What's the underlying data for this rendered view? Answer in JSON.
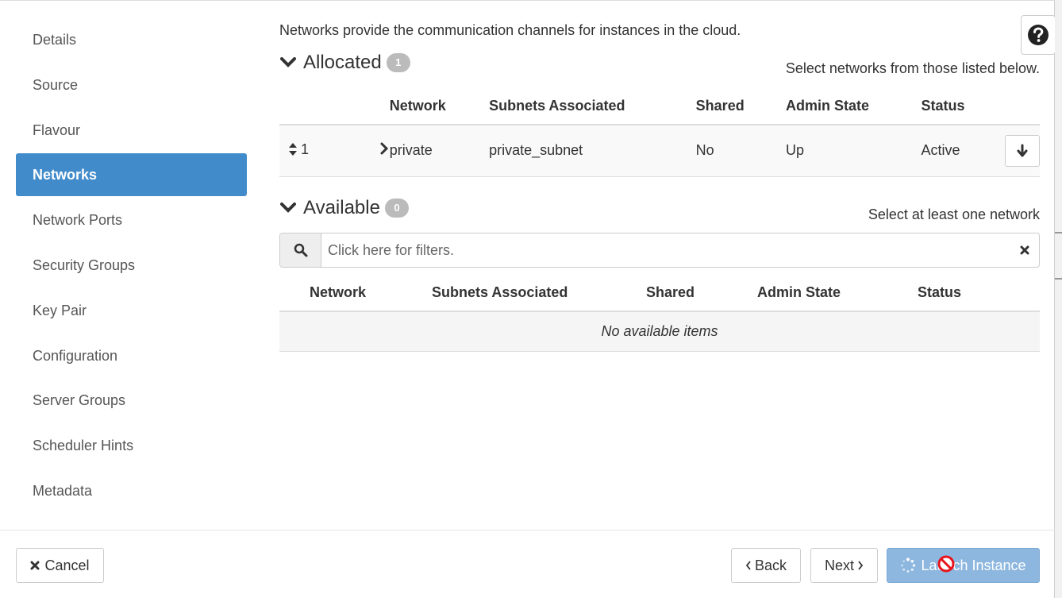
{
  "sidebar": {
    "items": [
      {
        "label": "Details"
      },
      {
        "label": "Source"
      },
      {
        "label": "Flavour"
      },
      {
        "label": "Networks"
      },
      {
        "label": "Network Ports"
      },
      {
        "label": "Security Groups"
      },
      {
        "label": "Key Pair"
      },
      {
        "label": "Configuration"
      },
      {
        "label": "Server Groups"
      },
      {
        "label": "Scheduler Hints"
      },
      {
        "label": "Metadata"
      }
    ],
    "active": "Networks"
  },
  "main": {
    "intro": "Networks provide the communication channels for instances in the cloud.",
    "allocated": {
      "title": "Allocated",
      "count": "1",
      "hint": "Select networks from those listed below.",
      "columns": [
        "Network",
        "Subnets Associated",
        "Shared",
        "Admin State",
        "Status"
      ],
      "rows": [
        {
          "order": "1",
          "network": "private",
          "subnets": "private_subnet",
          "shared": "No",
          "admin_state": "Up",
          "status": "Active"
        }
      ]
    },
    "available": {
      "title": "Available",
      "count": "0",
      "hint": "Select at least one network",
      "filter_placeholder": "Click here for filters.",
      "columns": [
        "Network",
        "Subnets Associated",
        "Shared",
        "Admin State",
        "Status"
      ],
      "empty_text": "No available items"
    }
  },
  "footer": {
    "cancel_label": "Cancel",
    "back_label": "Back",
    "next_label": "Next",
    "launch_label": "Launch Instance"
  },
  "colors": {
    "active_nav": "#428bca",
    "launch_button": "#8db7df",
    "badge": "#bbbbbb"
  },
  "icons": [
    "question-circle-icon",
    "chevron-down-icon",
    "sort-icon",
    "chevron-right-icon",
    "arrow-down-icon",
    "search-icon",
    "times-icon",
    "spinner-icon",
    "not-allowed-cursor-icon",
    "chevron-left-icon"
  ]
}
